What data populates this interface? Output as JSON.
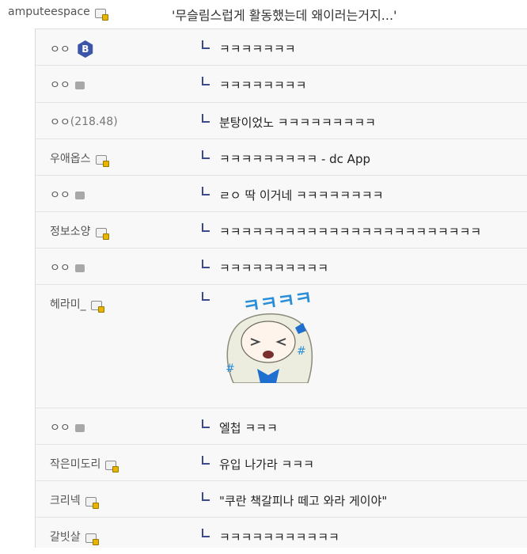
{
  "header": {
    "author": "amputeespace",
    "title": "'무슬림스럽게 활동했는데 왜이러는거지...'"
  },
  "badges": {
    "b_label": "B"
  },
  "sticker": {
    "text": "ㅋㅋㅋㅋ"
  },
  "comments": [
    {
      "name": "ㅇㅇ",
      "text": "ㅋㅋㅋㅋㅋㅋㅋ"
    },
    {
      "name": "ㅇㅇ",
      "text": "ㅋㅋㅋㅋㅋㅋㅋㅋ"
    },
    {
      "name": "ㅇㅇ",
      "ip": "(218.48)",
      "text": "분탕이었노 ㅋㅋㅋㅋㅋㅋㅋㅋㅋ"
    },
    {
      "name": "우애옵스",
      "text": "ㅋㅋㅋㅋㅋㅋㅋㅋㅋ - dc App"
    },
    {
      "name": "ㅇㅇ",
      "text": "ㄹㅇ 딱 이거네 ㅋㅋㅋㅋㅋㅋㅋㅋ"
    },
    {
      "name": "정보소양",
      "text": "ㅋㅋㅋㅋㅋㅋㅋㅋㅋㅋㅋㅋㅋㅋㅋㅋㅋㅋㅋㅋㅋㅋㅋㅋ"
    },
    {
      "name": "ㅇㅇ",
      "text": "ㅋㅋㅋㅋㅋㅋㅋㅋㅋㅋ"
    },
    {
      "name": "헤라미_",
      "text": ""
    },
    {
      "name": "ㅇㅇ",
      "text": "엘첩 ㅋㅋㅋ"
    },
    {
      "name": "작은미도리",
      "text": "유입 나가라 ㅋㅋㅋ"
    },
    {
      "name": "크리넥",
      "text": "\"쿠란 책갈피나 떼고 와라 게이야\""
    },
    {
      "name": "갈빗살",
      "text": "ㅋㅋㅋㅋㅋㅋㅋㅋㅋㅋㅋ"
    }
  ]
}
